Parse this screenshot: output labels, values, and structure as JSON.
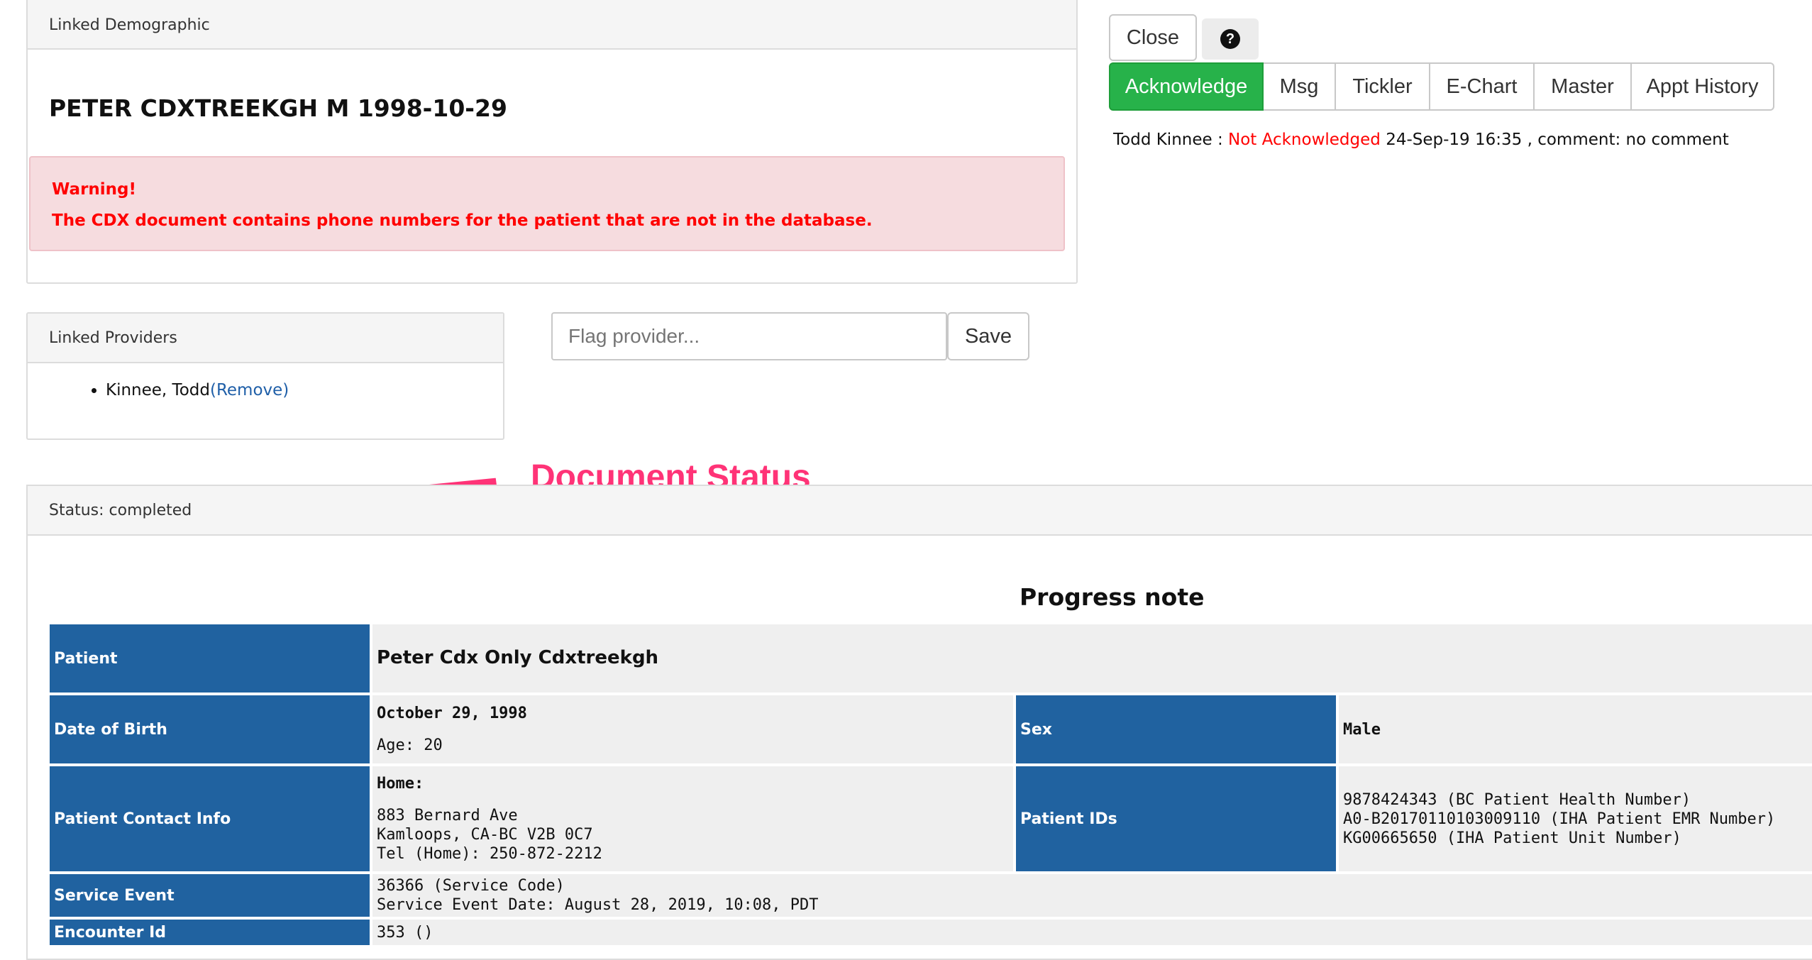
{
  "demographic": {
    "header": "Linked Demographic",
    "patient_line": "PETER CDXTREEKGH M 1998-10-29",
    "warning_title": "Warning!",
    "warning_text": "The CDX document contains phone numbers for the patient that are not in the database."
  },
  "providers": {
    "header": "Linked Providers",
    "items": [
      {
        "name": "Kinnee, Todd",
        "remove_label": "(Remove)"
      }
    ]
  },
  "flag": {
    "placeholder": "Flag provider...",
    "save_label": "Save"
  },
  "toolbar": {
    "close_label": "Close",
    "help_icon": "question-circle-icon",
    "buttons": [
      "Acknowledge",
      "Msg",
      "Tickler",
      "E-Chart",
      "Master",
      "Appt History"
    ],
    "accent_color": "#27b24a"
  },
  "ack": {
    "provider": "Todd Kinnee",
    "separator": ":",
    "status": "Not Acknowledged",
    "status_color": "#ff0000",
    "datetime": "24-Sep-19 16:35",
    "comment": ", comment: no comment"
  },
  "annotation": {
    "label": "Document Status",
    "color": "#ff3377"
  },
  "status": {
    "text": "Status: completed"
  },
  "document": {
    "title": "Progress note",
    "header_color": "#2062a0",
    "patient_label": "Patient",
    "patient_name": "Peter Cdx Only Cdxtreekgh",
    "dob_label": "Date of Birth",
    "dob": "October 29, 1998",
    "age": "Age: 20",
    "sex_label": "Sex",
    "sex": "Male",
    "contact_label": "Patient Contact Info",
    "contact_type": "Home:",
    "address1": "883 Bernard Ave",
    "address2": "Kamloops, CA-BC V2B 0C7",
    "tel": "Tel (Home): 250-872-2212",
    "ids_label": "Patient IDs",
    "ids": [
      "9878424343 (BC Patient Health Number)",
      "A0-B20170110103009110 (IHA Patient EMR Number)",
      "KG00665650 (IHA Patient Unit Number)"
    ],
    "service_label": "Service Event",
    "service_code": "36366 (Service Code)",
    "service_date": "Service Event Date: August 28, 2019, 10:08, PDT",
    "encounter_label": "Encounter Id",
    "encounter": "353 ()"
  }
}
